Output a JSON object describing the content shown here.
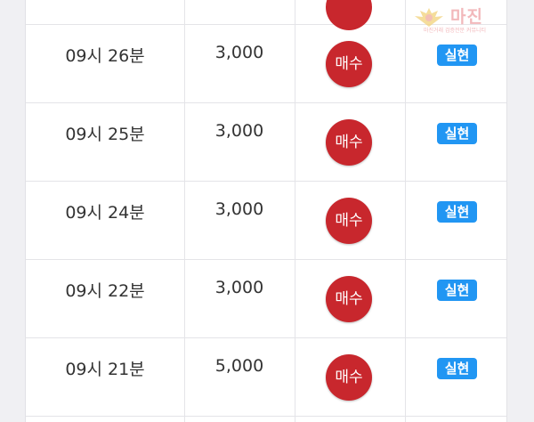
{
  "columns": [
    "time",
    "amount",
    "action",
    "status"
  ],
  "rows": [
    {
      "time": "09시 26분",
      "amount": "3,000",
      "action": "매수",
      "status": "실현"
    },
    {
      "time": "09시 25분",
      "amount": "3,000",
      "action": "매수",
      "status": "실현"
    },
    {
      "time": "09시 24분",
      "amount": "3,000",
      "action": "매수",
      "status": "실현"
    },
    {
      "time": "09시 22분",
      "amount": "3,000",
      "action": "매수",
      "status": "실현"
    },
    {
      "time": "09시 21분",
      "amount": "5,000",
      "action": "매수",
      "status": "실현"
    }
  ],
  "watermark": {
    "text": "마진",
    "subtitle": "마진거래 검증전문 커뮤니티"
  },
  "colors": {
    "buy_badge": "#c8272d",
    "status_badge": "#2196f3",
    "watermark": "#f2b8bb"
  }
}
